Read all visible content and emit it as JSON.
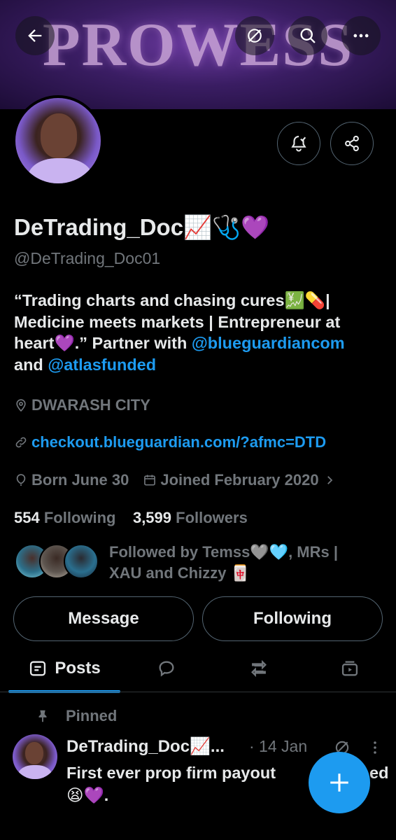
{
  "banner": {
    "text": "PROWESS"
  },
  "header_icons": [
    "back-arrow-icon",
    "grok-icon",
    "search-icon",
    "more-icon"
  ],
  "profile": {
    "name": "DeTrading_Doc📈🩺💜",
    "handle": "@DeTrading_Doc01",
    "bio_line1": "“Trading charts and chasing cures💹💊|",
    "bio_line2": "Medicine meets markets | Entrepreneur at",
    "bio_line3_pre": "heart💜.” Partner with ",
    "bio_mention1": "@blueguardiancom",
    "bio_line4_pre": "and ",
    "bio_mention2": "@atlasfunded",
    "location": "DWARASH CITY",
    "website": "checkout.blueguardian.com/?afmc=DTD",
    "birthday": "Born June 30",
    "joined": "Joined February 2020",
    "following_count": "554",
    "following_label": "Following",
    "followers_count": "3,599",
    "followers_label": "Followers",
    "followed_by_line1": "Followed by Temss🩶🩵, MRs |",
    "followed_by_line2": "XAU and Chizzy 🀄"
  },
  "actions": {
    "message": "Message",
    "following": "Following"
  },
  "tabs": [
    {
      "label": "Posts",
      "icon": "posts-icon",
      "active": true
    },
    {
      "label": "",
      "icon": "replies-icon"
    },
    {
      "label": "",
      "icon": "reposts-icon"
    },
    {
      "label": "",
      "icon": "media-icon"
    }
  ],
  "pinned_tweet": {
    "pinned_label": "Pinned",
    "name": "DeTrading_Doc📈...",
    "date": "· 14 Jan",
    "text_line1": "First ever prop firm payout",
    "text_line1_end": "ed",
    "text_line2": "😫💜."
  },
  "colors": {
    "accent": "#1d9bf0",
    "muted": "#71767b",
    "text": "#e7e9ea",
    "background": "#000000",
    "border": "#536471"
  }
}
